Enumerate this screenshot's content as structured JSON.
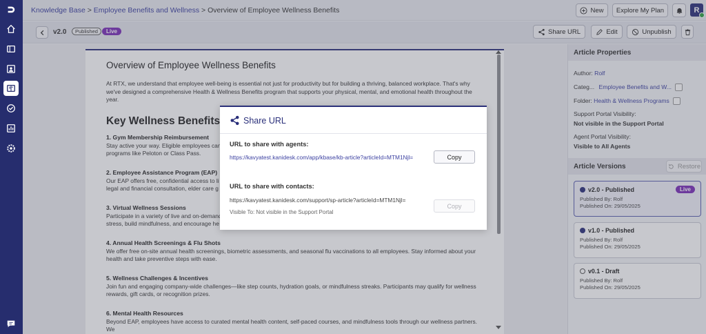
{
  "nav": {
    "items": [
      "logo-icon",
      "home-icon",
      "tickets-icon",
      "contacts-icon",
      "knowledge-base-icon",
      "tasks-icon",
      "reports-icon",
      "settings-icon",
      "chat-icon"
    ]
  },
  "header": {
    "breadcrumb": [
      "Knowledge Base",
      "Employee Benefits and Wellness",
      "Overview of Employee Wellness Benefits"
    ],
    "separator": ">",
    "new_label": "New",
    "explore_label": "Explore My Plan",
    "avatar_initial": "R"
  },
  "toolbar": {
    "version": "v2.0",
    "status": "Published",
    "live": "Live",
    "share_label": "Share URL",
    "edit_label": "Edit",
    "unpublish_label": "Unpublish"
  },
  "article": {
    "title": "Overview of Employee Wellness Benefits",
    "intro": "At RTX, we understand that employee well-being is essential not just for productivity but for building a thriving, balanced workplace. That's why we've designed a comprehensive Health & Wellness Benefits program that supports your physical, mental, and emotional health throughout the year.",
    "section_heading": "Key Wellness Benefits Av",
    "sections": [
      {
        "title": "1. Gym Membership Reimbursement",
        "body": "Stay active your way. Eligible employees can programs like Peloton or Class Pass."
      },
      {
        "title": "2. Employee Assistance Program (EAP)",
        "body": "Our EAP offers free, confidential access to li legal and financial consultation, elder care g"
      },
      {
        "title": "3. Virtual Wellness Sessions",
        "body": "Participate in a variety of live and on-demand stress, build mindfulness, and encourage he"
      },
      {
        "title": "4. Annual Health Screenings & Flu Shots",
        "body": "We offer free on-site annual health screenings, biometric assessments, and seasonal flu vaccinations to all employees. Stay informed about your health and take preventive steps with ease."
      },
      {
        "title": "5. Wellness Challenges & Incentives",
        "body": "Join fun and engaging company-wide challenges—like step counts, hydration goals, or mindfulness streaks. Participants may qualify for wellness rewards, gift cards, or recognition prizes."
      },
      {
        "title": "6. Mental Health Resources",
        "body": "Beyond EAP, employees have access to curated mental health content, self-paced courses, and mindfulness tools through our wellness partners. We"
      }
    ]
  },
  "properties": {
    "title": "Article Properties",
    "author_label": "Author:",
    "author": "Rolf",
    "category_label": "Categ...",
    "category": "Employee Benefits and W...",
    "folder_label": "Folder:",
    "folder": "Health & Wellness Programs",
    "support_label": "Support Portal Visibility:",
    "support_value": "Not visible in the Support Portal",
    "agent_label": "Agent Portal Visibility:",
    "agent_value": "Visible to All Agents"
  },
  "versions": {
    "title": "Article Versions",
    "restore_label": "Restore",
    "items": [
      {
        "label": "v2.0 - Published",
        "by": "Published By: Rolf",
        "on": "Published On: 29/05/2025",
        "live": "Live"
      },
      {
        "label": "v1.0 - Published",
        "by": "Published By: Rolf",
        "on": "Published On: 29/05/2025"
      },
      {
        "label": "v0.1 - Draft",
        "by": "Published By: Rolf",
        "on": "Published On: 29/05/2025"
      }
    ]
  },
  "modal": {
    "title": "Share URL",
    "agents_label": "URL to share with agents:",
    "agents_url": "https://kavyatest.kanidesk.com/app/kbase/kb-article?articleId=MTM1Njl=",
    "contacts_label": "URL to share with contacts:",
    "contacts_url": "https://kavyatest.kanidesk.com/support/sp-article?articleId=MTM1Njl=",
    "visible_to": "Visible To: Not visible in the Support Portal",
    "copy_label": "Copy"
  },
  "colors": {
    "nav_bg": "#262d6e",
    "accent": "#2a2f7a",
    "link": "#3a3fa0",
    "live": "#7b2fb8",
    "avatar": "#2a2f7a",
    "avatar_badge": "#2ea043"
  }
}
